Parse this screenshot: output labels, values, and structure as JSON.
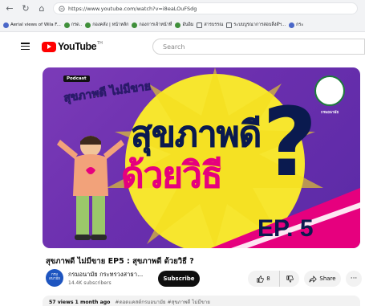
{
  "browser": {
    "url": "https://www.youtube.com/watch?v=i8eaLOuFSdg",
    "bookmarks": [
      {
        "label": "Aerial views of Wila F...",
        "icon": "blue"
      },
      {
        "label": "กรด..",
        "icon": "green"
      },
      {
        "label": "กองคลัง | หน้าหลัก",
        "icon": "green"
      },
      {
        "label": "กองการเจ้าหน้าที่",
        "icon": "green"
      },
      {
        "label": "อันอิม",
        "icon": "green"
      },
      {
        "label": "สารบรรณ",
        "icon": "doc"
      },
      {
        "label": "ระบบบูรณาการสอบสิ่งส์ฯ...",
        "icon": "doc"
      },
      {
        "label": "กระ",
        "icon": "blue"
      }
    ]
  },
  "header": {
    "logo_text": "YouTube",
    "logo_region": "TH",
    "search_placeholder": "Search"
  },
  "thumbnail": {
    "badge": "Podcast",
    "logo_text": "สุขภาพดี ไม่มีขาย",
    "title_line1": "สุขภาพดี",
    "title_line2": "ด้วยวิธี",
    "question_mark": "?",
    "episode": "EP. 5",
    "org_label": "กรมอนามัย"
  },
  "video": {
    "title": "สุขภาพดี ไม่มีขาย EP5 : สุขภาพดี ด้วยวิธี ?",
    "channel_name": "กรมอนามัย กระทรวงสาธา...",
    "channel_avatar_text": "กรม อนามัย",
    "subscribers": "14.4K subscribers",
    "subscribe_label": "Subscribe",
    "likes": "8",
    "share_label": "Share",
    "more_label": "···",
    "views": "57 views",
    "age": "1 month ago",
    "hashtags": "#ดอดแคสต์กรมอนามัย #สุขภาพดี ไม่มีขาย"
  },
  "colors": {
    "youtube_red": "#ff0000",
    "thumb_purple": "#6b2fae",
    "thumb_yellow": "#f7e62e",
    "thumb_magenta": "#e6007e",
    "thumb_navy": "#0a1a4f"
  }
}
